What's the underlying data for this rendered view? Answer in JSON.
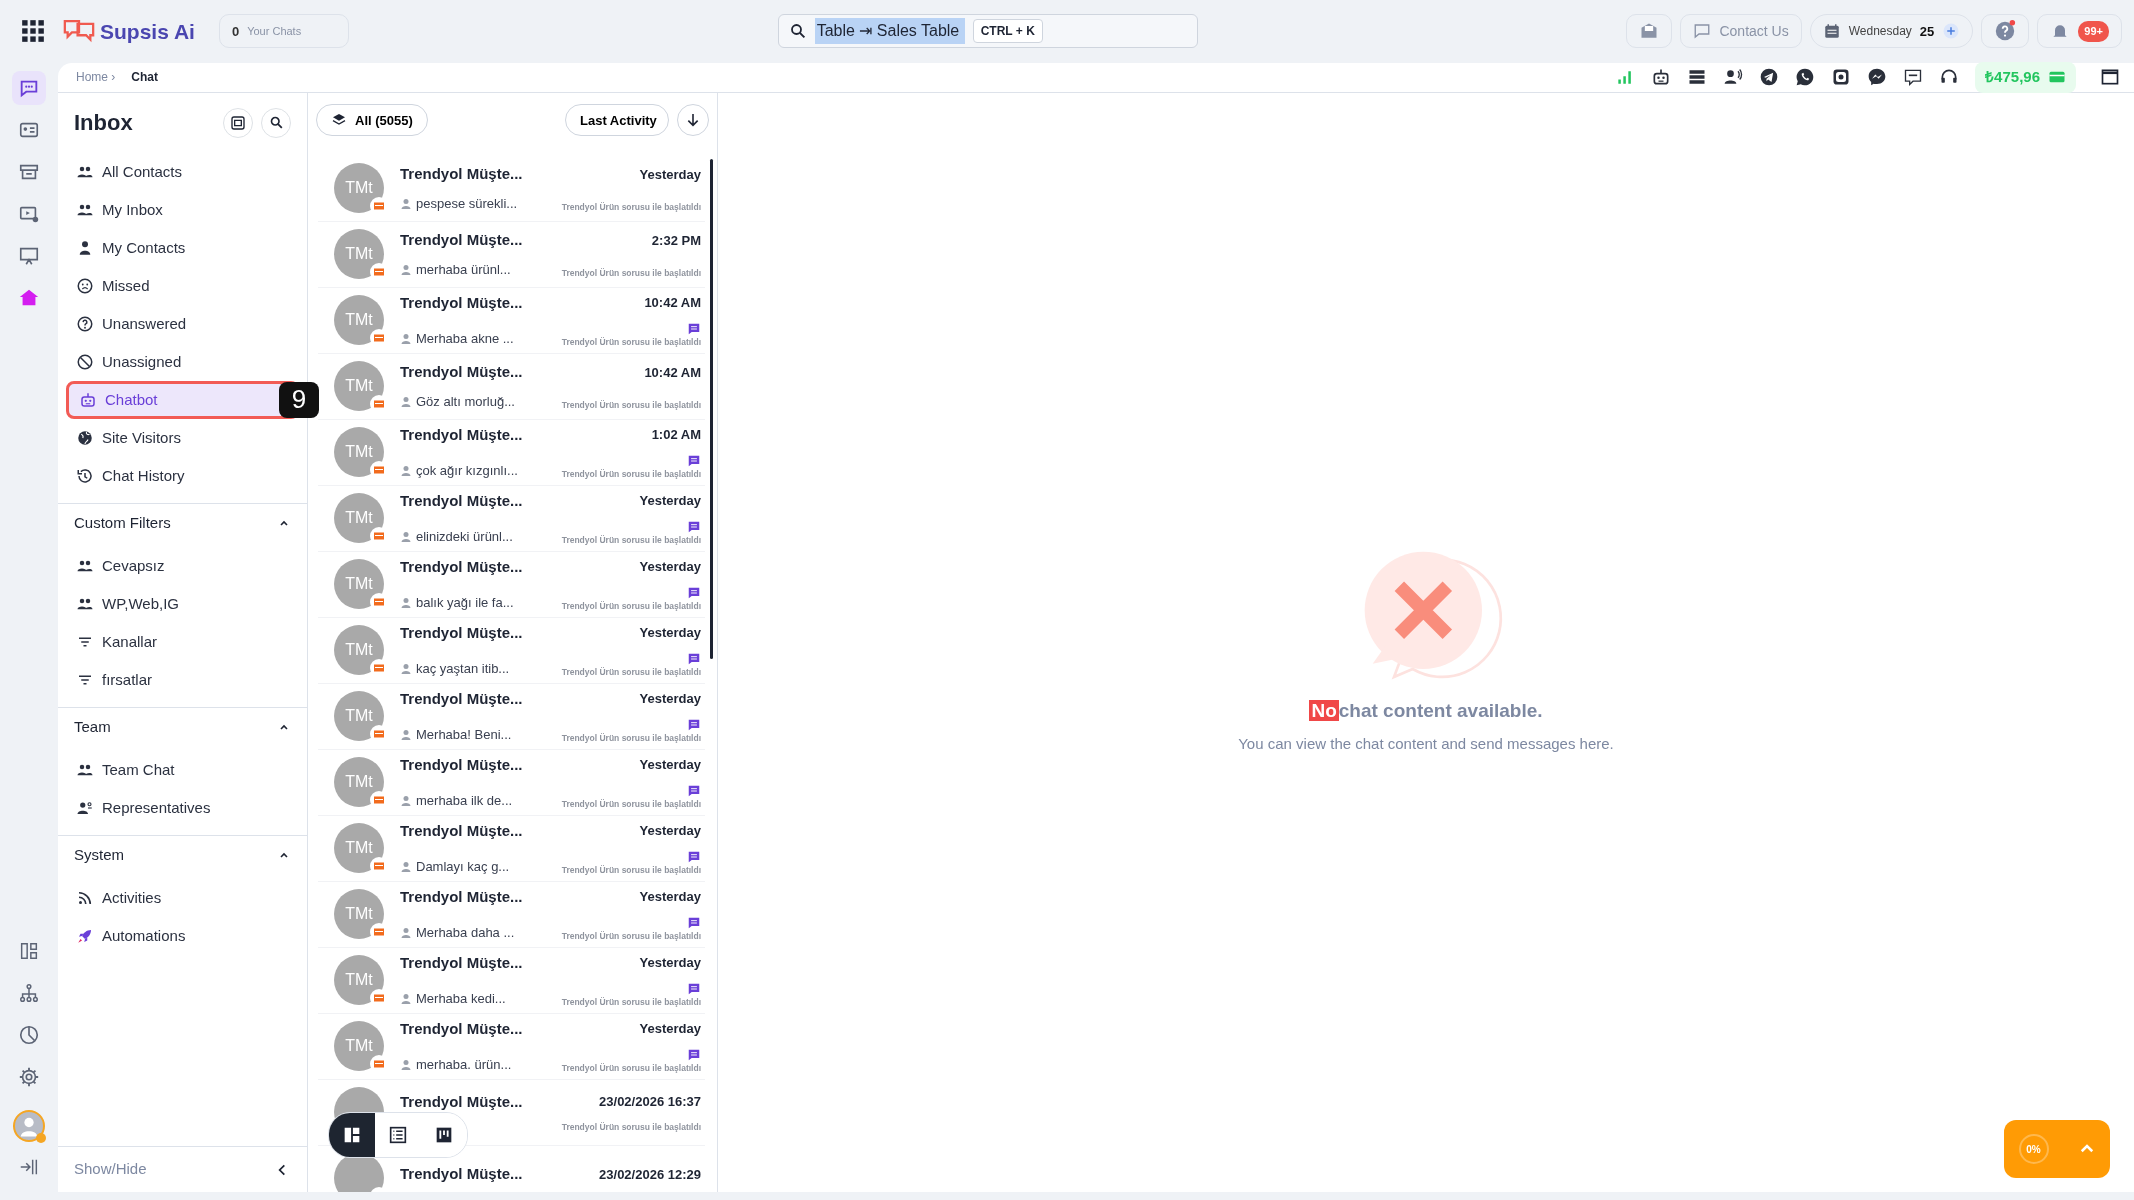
{
  "header": {
    "logo": "Supsis Ai",
    "chats_count": "0",
    "chats_label": "Your Chats",
    "search_value": "Table ⇥ Sales Table",
    "search_shortcut": "CTRL + K",
    "contact": "Contact Us",
    "date_day": "Wednesday",
    "date_num": "25",
    "notifications": "99+"
  },
  "rail": {
    "top": [
      {
        "selected": true
      },
      {
        "selected": false
      },
      {
        "selected": false
      },
      {
        "selected": false
      },
      {
        "selected": false
      },
      {
        "selected": false
      }
    ]
  },
  "breadcrumb": {
    "home": "Home ›",
    "current": "Chat"
  },
  "toolbar": {
    "balance": "₺475,96"
  },
  "sidebar": {
    "title": "Inbox",
    "items": [
      {
        "label": "All Contacts",
        "selected": false
      },
      {
        "label": "My Inbox",
        "selected": false
      },
      {
        "label": "My Contacts",
        "selected": false
      },
      {
        "label": "Missed",
        "selected": false
      },
      {
        "label": "Unanswered",
        "selected": false
      },
      {
        "label": "Unassigned",
        "selected": false
      },
      {
        "label": "Chatbot",
        "selected": true,
        "step_badge": "9"
      },
      {
        "label": "Site Visitors",
        "selected": false
      },
      {
        "label": "Chat History",
        "selected": false
      }
    ],
    "sections": [
      {
        "title": "Custom Filters",
        "expanded": true,
        "items": [
          "Cevapsız",
          "WP,Web,IG",
          "Kanallar",
          "fırsatlar"
        ]
      },
      {
        "title": "Team",
        "expanded": true,
        "items": [
          "Team Chat",
          "Representatives"
        ]
      },
      {
        "title": "System",
        "expanded": true,
        "items": [
          "Activities",
          "Automations"
        ]
      }
    ],
    "footer": "Show/Hide"
  },
  "chat_list": {
    "filter": "All (5055)",
    "sort": "Last Activity",
    "rows": [
      {
        "name": "Trendyol Müşte...",
        "initials": "TMt",
        "preview": "pespese sürekli...",
        "time": "Yesterday",
        "unread_icon": false,
        "origin": "Trendyol Ürün sorusu ile başlatıldı"
      },
      {
        "name": "Trendyol Müşte...",
        "initials": "TMt",
        "preview": "merhaba ürünl...",
        "time": "2:32 PM",
        "unread_icon": false,
        "origin": "Trendyol Ürün sorusu ile başlatıldı"
      },
      {
        "name": "Trendyol Müşte...",
        "initials": "TMt",
        "preview": "Merhaba akne ...",
        "time": "10:42 AM",
        "unread_icon": true,
        "origin": "Trendyol Ürün sorusu ile başlatıldı"
      },
      {
        "name": "Trendyol Müşte...",
        "initials": "TMt",
        "preview": "Göz altı morluğ...",
        "time": "10:42 AM",
        "unread_icon": false,
        "origin": "Trendyol Ürün sorusu ile başlatıldı"
      },
      {
        "name": "Trendyol Müşte...",
        "initials": "TMt",
        "preview": "çok ağır kızgınlı...",
        "time": "1:02 AM",
        "unread_icon": true,
        "origin": "Trendyol Ürün sorusu ile başlatıldı"
      },
      {
        "name": "Trendyol Müşte...",
        "initials": "TMt",
        "preview": "elinizdeki ürünl...",
        "time": "Yesterday",
        "unread_icon": true,
        "origin": "Trendyol Ürün sorusu ile başlatıldı"
      },
      {
        "name": "Trendyol Müşte...",
        "initials": "TMt",
        "preview": "balık yağı ile fa...",
        "time": "Yesterday",
        "unread_icon": true,
        "origin": "Trendyol Ürün sorusu ile başlatıldı"
      },
      {
        "name": "Trendyol Müşte...",
        "initials": "TMt",
        "preview": "kaç yaştan itib...",
        "time": "Yesterday",
        "unread_icon": true,
        "origin": "Trendyol Ürün sorusu ile başlatıldı"
      },
      {
        "name": "Trendyol Müşte...",
        "initials": "TMt",
        "preview": "Merhaba! Beni...",
        "time": "Yesterday",
        "unread_icon": true,
        "origin": "Trendyol Ürün sorusu ile başlatıldı"
      },
      {
        "name": "Trendyol Müşte...",
        "initials": "TMt",
        "preview": "merhaba ilk de...",
        "time": "Yesterday",
        "unread_icon": true,
        "origin": "Trendyol Ürün sorusu ile başlatıldı"
      },
      {
        "name": "Trendyol Müşte...",
        "initials": "TMt",
        "preview": "Damlayı kaç g...",
        "time": "Yesterday",
        "unread_icon": true,
        "origin": "Trendyol Ürün sorusu ile başlatıldı"
      },
      {
        "name": "Trendyol Müşte...",
        "initials": "TMt",
        "preview": "Merhaba daha ...",
        "time": "Yesterday",
        "unread_icon": true,
        "origin": "Trendyol Ürün sorusu ile başlatıldı"
      },
      {
        "name": "Trendyol Müşte...",
        "initials": "TMt",
        "preview": "Merhaba kedi...",
        "time": "Yesterday",
        "unread_icon": true,
        "origin": "Trendyol Ürün sorusu ile başlatıldı"
      },
      {
        "name": "Trendyol Müşte...",
        "initials": "TMt",
        "preview": "merhaba. ürün...",
        "time": "Yesterday",
        "unread_icon": true,
        "origin": "Trendyol Ürün sorusu ile başlatıldı"
      },
      {
        "name": "Trendyol Müşte...",
        "time": "23/02/2026 16:37",
        "unread_icon": false,
        "origin": "Trendyol Ürün sorusu ile başlatıldı"
      },
      {
        "name": "Trendyol Müşte...",
        "time": "23/02/2026 12:29",
        "unread_icon": false
      }
    ],
    "views": [
      {
        "selected": true
      },
      {
        "selected": false
      },
      {
        "selected": false
      }
    ]
  },
  "empty_state": {
    "title_highlight": "No",
    "title_rest": "chat content available.",
    "subtitle": "You can view the chat content and send messages here."
  },
  "progress_widget": {
    "percent": "0%"
  }
}
